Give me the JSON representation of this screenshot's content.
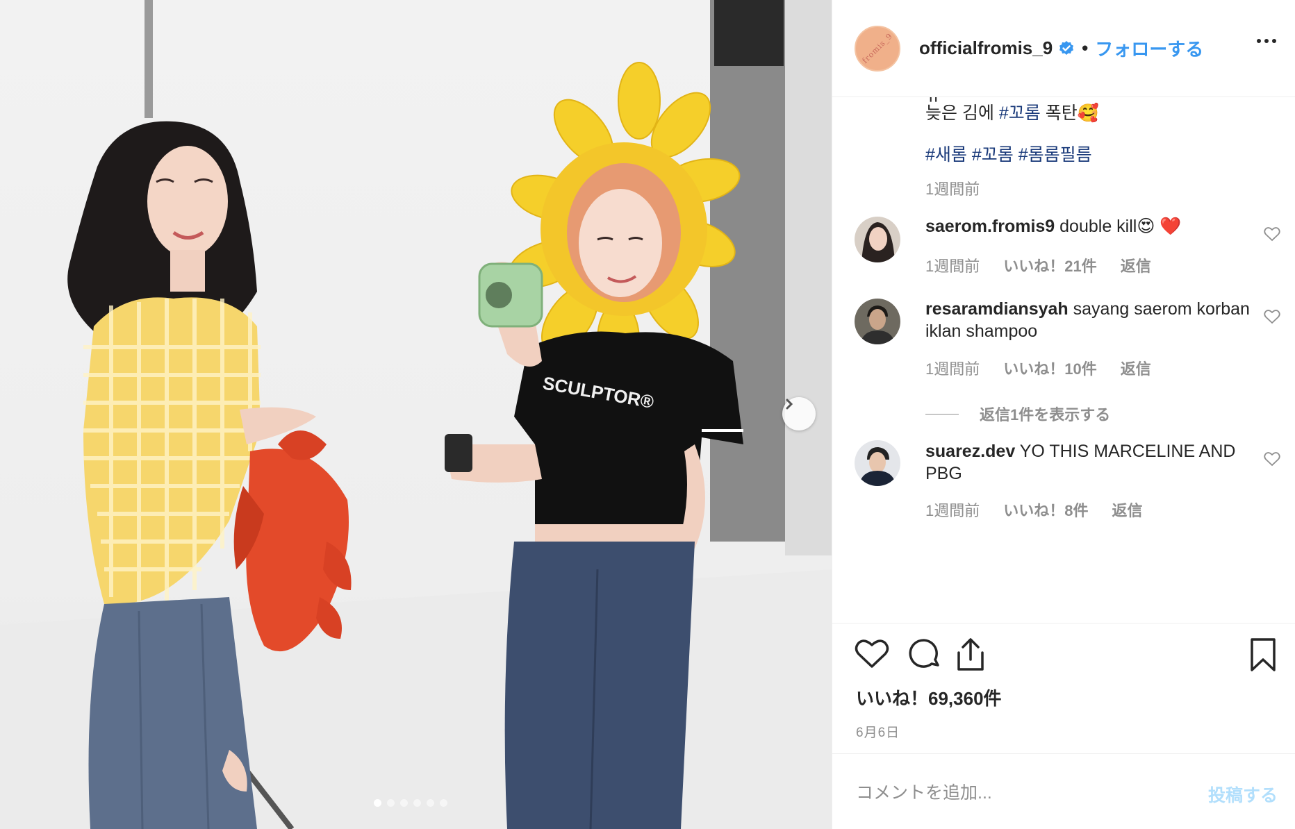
{
  "post": {
    "username": "officialfromis_9",
    "separator": "•",
    "follow_label": "フォローする",
    "avatar_text": "fromis_9"
  },
  "caption": {
    "partial_line": "ㅠ",
    "line1_text": "늦은 김에 ",
    "line1_tag": "#꼬롬",
    "line1_tail": " 폭탄🥰",
    "hashtags": "#새롬 #꼬롬 #롬롬필름",
    "time": "1週間前"
  },
  "comments": [
    {
      "user": "saerom.fromis9",
      "text": " double kill😍 ❤️",
      "time": "1週間前",
      "likes": "いいね！21件",
      "reply": "返信"
    },
    {
      "user": "resaramdiansyah",
      "text": " sayang saerom korban iklan shampoo",
      "time": "1週間前",
      "likes": "いいね！10件",
      "reply": "返信",
      "view_replies": "返信1件を表示する"
    },
    {
      "user": "suarez.dev",
      "text": " YO THIS MARCELINE AND PBG",
      "time": "1週間前",
      "likes": "いいね！8件",
      "reply": "返信"
    }
  ],
  "actions": {
    "likes_label": "いいね！69,360件",
    "date": "6月6日"
  },
  "add_comment": {
    "placeholder": "コメントを追加...",
    "post_label": "投稿する"
  },
  "photo": {
    "carousel_total": 6,
    "carousel_active": 1,
    "shirt_text": "SCULPTOR®"
  },
  "colors": {
    "accent": "#3897f0",
    "hashtag": "#1a3a7a",
    "muted": "#8e8e8e",
    "post_disabled": "#b2dffc",
    "verified": "#3897f0"
  },
  "icons": {
    "verified": "verified-badge-icon",
    "more": "more-options-icon",
    "next": "chevron-right-icon",
    "like": "heart-icon",
    "comment": "comment-bubble-icon",
    "share": "share-icon",
    "save": "bookmark-icon"
  }
}
